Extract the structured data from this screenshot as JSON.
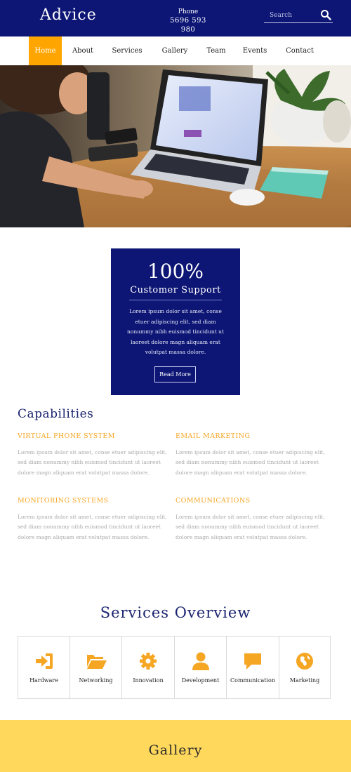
{
  "header": {
    "logo": "Advice",
    "phone_label": "Phone",
    "phone_number": "5696 593 980",
    "search_placeholder": "Search"
  },
  "nav": {
    "items": [
      "Home",
      "About",
      "Services",
      "Gallery",
      "Team",
      "Events",
      "Contact"
    ],
    "active": "Home"
  },
  "support": {
    "big": "100%",
    "title": "Customer Support",
    "text": "Lorem ipsum dolor sit amet, conse etuer adipiscing elit, sed diam nonummy nibh euismod tincidunt ut laoreet dolore magn aliquam erat volutpat massa dolore.",
    "button": "Read More"
  },
  "capabilities": {
    "title": "Capabilities",
    "items": [
      {
        "title": "VIRTUAL PHONE SYSTEM",
        "text": "Lorem ipsum dolor sit amet, conse etuer adipiscing elit, sed diam nonummy nibh euismod tincidunt ut laoreet dolore magn aliquam erat volutpat massa dolore."
      },
      {
        "title": "EMAIL MARKETING",
        "text": "Lorem ipsum dolor sit amet, conse etuer adipiscing elit, sed diam nonummy nibh euismod tincidunt ut laoreet dolore magn aliquam erat volutpat massa dolore."
      },
      {
        "title": "MONITORING SYSTEMS",
        "text": "Lorem ipsum dolor sit amet, conse etuer adipiscing elit, sed diam nonummy nibh euismod tincidunt ut laoreet dolore magn aliquam erat volutpat massa dolore."
      },
      {
        "title": "COMMUNICATIONS",
        "text": "Lorem ipsum dolor sit amet, conse etuer adipiscing elit, sed diam nonummy nibh euismod tincidunt ut laoreet dolore magn aliquam erat volutpat massa dolore."
      }
    ]
  },
  "services": {
    "title": "Services Overview",
    "items": [
      {
        "label": "Hardware",
        "icon": "sign-in-icon"
      },
      {
        "label": "Networking",
        "icon": "folder-open-icon"
      },
      {
        "label": "Innovation",
        "icon": "gear-icon"
      },
      {
        "label": "Development",
        "icon": "user-icon"
      },
      {
        "label": "Communication",
        "icon": "comment-icon"
      },
      {
        "label": "Marketing",
        "icon": "globe-icon"
      }
    ]
  },
  "gallery": {
    "title": "Gallery"
  },
  "colors": {
    "brand_navy": "#0d1675",
    "accent_orange": "#ffa500",
    "gallery_yellow": "#ffd85c",
    "caption_gray": "#aaaaaa"
  }
}
